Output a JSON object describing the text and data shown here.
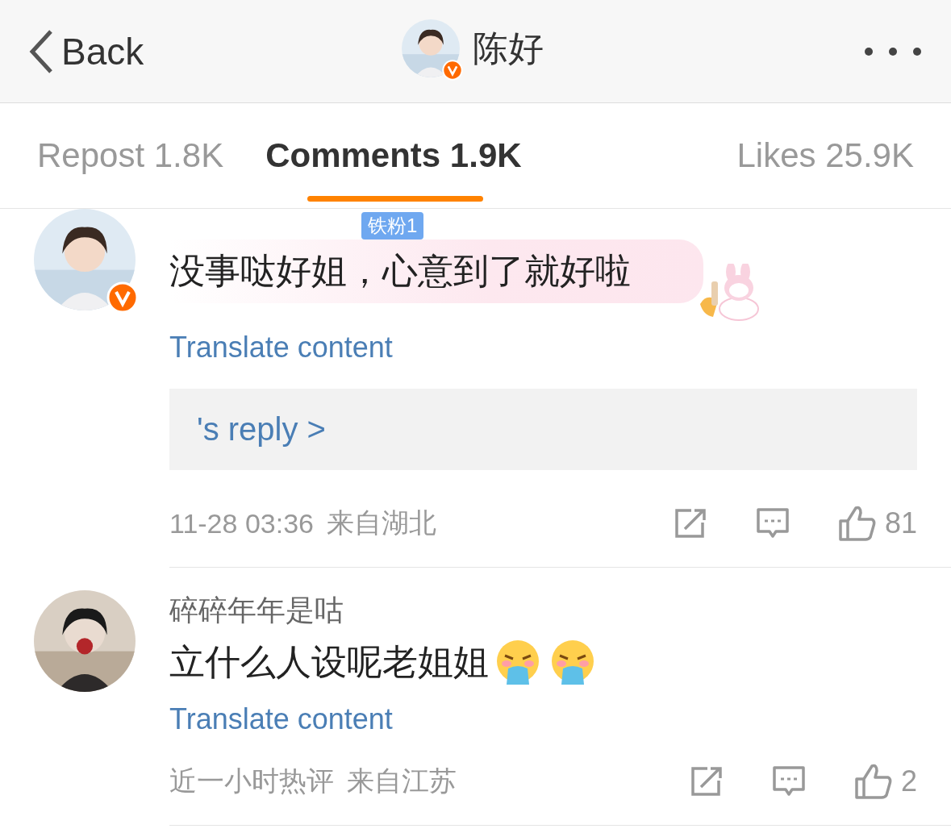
{
  "header": {
    "back_label": "Back",
    "title": "陈好",
    "verified": true
  },
  "tabs": [
    {
      "label": "Repost 1.8K",
      "selected": false
    },
    {
      "label": "Comments 1.9K",
      "selected": true
    },
    {
      "label": "Likes 25.9K",
      "selected": false
    }
  ],
  "comments": [
    {
      "verified": true,
      "badge": "铁粉1",
      "text": "没事哒好姐，心意到了就好啦",
      "bubble": true,
      "translate": "Translate content",
      "reply": "'s reply >",
      "time": "11-28 03:36",
      "location": "来自湖北",
      "likes": "81"
    },
    {
      "verified": false,
      "username": "碎碎年年是咕",
      "text": "立什么人设呢老姐姐",
      "bubble": false,
      "emojis": [
        {
          "kind": "puking"
        },
        {
          "kind": "puking"
        }
      ],
      "translate": "Translate content",
      "time": "近一小时热评",
      "location": "来自江苏",
      "likes": "2"
    }
  ]
}
